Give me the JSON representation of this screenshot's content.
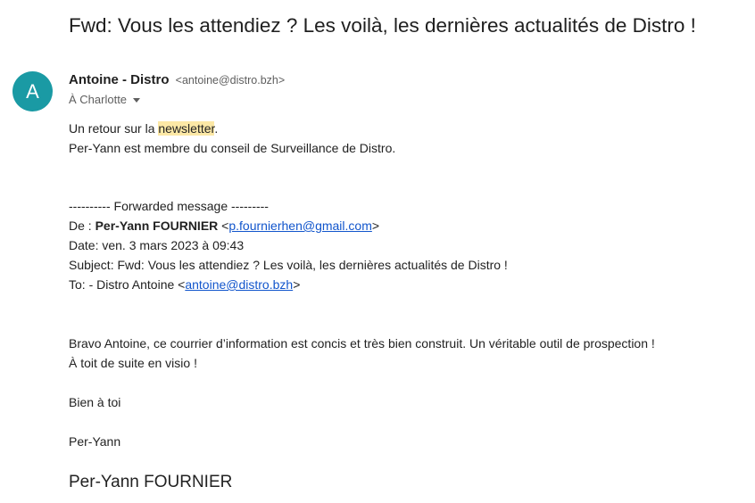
{
  "email": {
    "subject": "Fwd: Vous les attendiez ? Les voilà, les dernières actualités de Distro !",
    "avatar_letter": "A",
    "sender_name": "Antoine - Distro",
    "sender_email": "<antoine@distro.bzh>",
    "recipient_line": "À Charlotte",
    "intro": {
      "before": "Un retour sur la ",
      "highlight": "newsletter",
      "after": "."
    },
    "intro_line2": "Per-Yann est membre du conseil de Surveillance de Distro.",
    "forwarded": {
      "header": "---------- Forwarded message ---------",
      "from_prefix": "De : ",
      "from_name": "Per-Yann FOURNIER",
      "from_open": " <",
      "from_email": "p.fournierhen@gmail.com",
      "from_close": ">",
      "date": "Date: ven. 3 mars 2023 à 09:43",
      "subject": "Subject: Fwd: Vous les attendiez ? Les voilà, les dernières actualités de Distro !",
      "to_prefix": "To: - Distro Antoine <",
      "to_email": "antoine@distro.bzh",
      "to_close": ">"
    },
    "message": {
      "line1": "Bravo Antoine, ce courrier d’information est concis et très bien construit. Un véritable outil de prospection !",
      "line2": "À toit de suite en visio !",
      "greeting": "Bien à toi",
      "sign": "Per-Yann",
      "signature_big": "Per-Yann FOURNIER"
    }
  }
}
